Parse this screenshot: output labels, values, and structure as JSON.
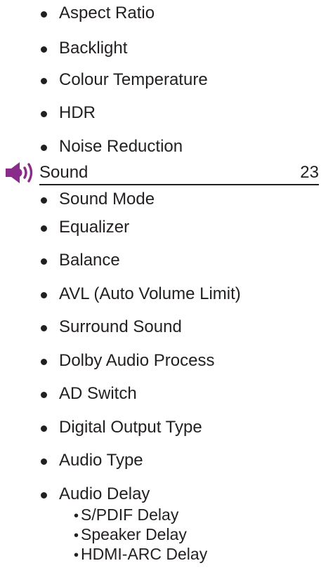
{
  "picture_items": [
    "Aspect Ratio",
    "Backlight",
    "Colour Temperature",
    "HDR",
    "Noise Reduction"
  ],
  "sound_section": {
    "title": "Sound",
    "page": "23",
    "icon": "speaker-icon",
    "icon_color": "#8a2c89",
    "items": [
      "Sound Mode",
      "Equalizer",
      "Balance",
      "AVL (Auto Volume Limit)",
      "Surround Sound",
      "Dolby Audio Process",
      "AD Switch",
      "Digital Output Type",
      "Audio Type",
      "Audio Delay"
    ],
    "audio_delay_subitems": [
      "S/PDIF Delay",
      "Speaker Delay",
      "HDMI-ARC Delay"
    ]
  }
}
